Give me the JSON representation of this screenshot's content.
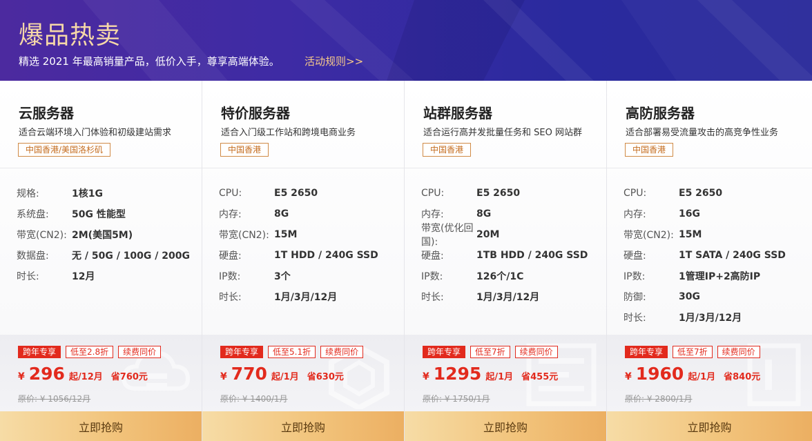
{
  "banner": {
    "title": "爆品热卖",
    "subtitle": "精选 2021 年最高销量产品，低价入手，尊享高端体验。",
    "rules_link": "活动规则>>"
  },
  "colors": {
    "accent_red": "#e22a1d",
    "gold": "#f2c47c",
    "banner_bg": "#3e2ba4",
    "tag_orange": "#c46b1c"
  },
  "cards": [
    {
      "title": "云服务器",
      "desc": "适合云端环境入门体验和初级建站需求",
      "tag": "中国香港/美国洛杉矶",
      "specs": [
        {
          "key": "规格:",
          "val": "1核1G"
        },
        {
          "key": "系统盘:",
          "val": "50G 性能型"
        },
        {
          "key": "带宽(CN2):",
          "val": "2M(美国5M)"
        },
        {
          "key": "数据盘:",
          "val": "无 / 50G / 100G / 200G"
        },
        {
          "key": "时长:",
          "val": "12月"
        }
      ],
      "badges": [
        "跨年专享",
        "低至2.8折",
        "续费同价"
      ],
      "currency": "¥",
      "price": "296",
      "unit": "起/12月",
      "save": "省760元",
      "original": "原价: ¥ 1056/12月",
      "buy": "立即抢购"
    },
    {
      "title": "特价服务器",
      "desc": "适合入门级工作站和跨境电商业务",
      "tag": "中国香港",
      "specs": [
        {
          "key": "CPU:",
          "val": "E5 2650"
        },
        {
          "key": "内存:",
          "val": "8G"
        },
        {
          "key": "带宽(CN2):",
          "val": "15M"
        },
        {
          "key": "硬盘:",
          "val": "1T HDD / 240G SSD"
        },
        {
          "key": "IP数:",
          "val": "3个"
        },
        {
          "key": "时长:",
          "val": "1月/3月/12月"
        }
      ],
      "badges": [
        "跨年专享",
        "低至5.1折",
        "续费同价"
      ],
      "currency": "¥",
      "price": "770",
      "unit": "起/1月",
      "save": "省630元",
      "original": "原价: ¥ 1400/1月",
      "buy": "立即抢购"
    },
    {
      "title": "站群服务器",
      "desc": "适合运行高并发批量任务和 SEO 网站群",
      "tag": "中国香港",
      "specs": [
        {
          "key": "CPU:",
          "val": "E5 2650"
        },
        {
          "key": "内存:",
          "val": "8G"
        },
        {
          "key": "带宽(优化回国):",
          "val": "20M"
        },
        {
          "key": "硬盘:",
          "val": "1TB HDD / 240G SSD"
        },
        {
          "key": "IP数:",
          "val": "126个/1C"
        },
        {
          "key": "时长:",
          "val": "1月/3月/12月"
        }
      ],
      "badges": [
        "跨年专享",
        "低至7折",
        "续费同价"
      ],
      "currency": "¥",
      "price": "1295",
      "unit": "起/1月",
      "save": "省455元",
      "original": "原价: ¥ 1750/1月",
      "buy": "立即抢购"
    },
    {
      "title": "高防服务器",
      "desc": "适合部署易受流量攻击的高竞争性业务",
      "tag": "中国香港",
      "specs": [
        {
          "key": "CPU:",
          "val": "E5 2650"
        },
        {
          "key": "内存:",
          "val": "16G"
        },
        {
          "key": "带宽(CN2):",
          "val": "15M"
        },
        {
          "key": "硬盘:",
          "val": "1T SATA / 240G SSD"
        },
        {
          "key": "IP数:",
          "val": "1管理IP+2高防IP"
        },
        {
          "key": "防御:",
          "val": "30G"
        },
        {
          "key": "时长:",
          "val": "1月/3月/12月"
        }
      ],
      "badges": [
        "跨年专享",
        "低至7折",
        "续费同价"
      ],
      "currency": "¥",
      "price": "1960",
      "unit": "起/1月",
      "save": "省840元",
      "original": "原价: ¥ 2800/1月",
      "buy": "立即抢购"
    }
  ]
}
